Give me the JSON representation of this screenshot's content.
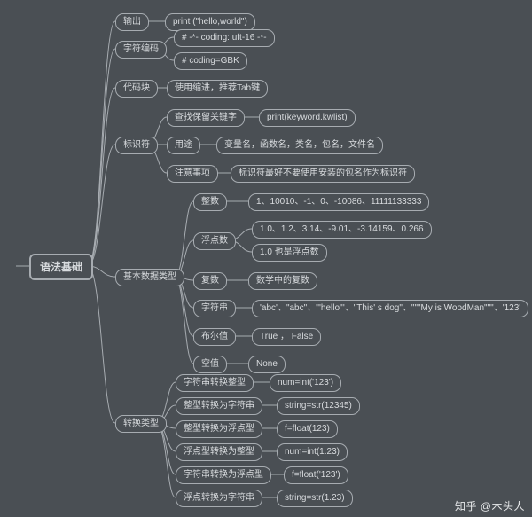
{
  "watermark": "知乎 @木头人",
  "root": {
    "label": "语法基础"
  },
  "b1": {
    "label": "输出"
  },
  "b1_1": {
    "label": "print (\"hello,world\")"
  },
  "b2": {
    "label": "字符编码"
  },
  "b2_1": {
    "label": "# -*- coding: uft-16 -*-"
  },
  "b2_2": {
    "label": "# coding=GBK"
  },
  "b3": {
    "label": "代码块"
  },
  "b3_1": {
    "label": "使用缩进，推荐Tab键"
  },
  "b4": {
    "label": "标识符"
  },
  "b4_1": {
    "label": "查找保留关键字"
  },
  "b4_1_1": {
    "label": "print(keyword.kwlist)"
  },
  "b4_2": {
    "label": "用途"
  },
  "b4_2_1": {
    "label": "变量名，函数名，类名，包名，文件名"
  },
  "b4_3": {
    "label": "注意事项"
  },
  "b4_3_1": {
    "label": "标识符最好不要使用安装的包名作为标识符"
  },
  "b5": {
    "label": "基本数据类型"
  },
  "b5_1": {
    "label": "整数"
  },
  "b5_1_1": {
    "label": "1、10010、-1、0、-10086、11111133333"
  },
  "b5_2": {
    "label": "浮点数"
  },
  "b5_2_1": {
    "label": "1.0、1.2、3.14、-9.01、-3.14159、0.266"
  },
  "b5_2_2": {
    "label": "1.0 也是浮点数"
  },
  "b5_3": {
    "label": "复数"
  },
  "b5_3_1": {
    "label": "数学中的复数"
  },
  "b5_4": {
    "label": "字符串"
  },
  "b5_4_1": {
    "label": "'abc'、\"abc\"、'''hello'''、\"This' s dog\"、\"\"\"My is WoodMan\"\"\"、'123'"
  },
  "b5_5": {
    "label": "布尔值"
  },
  "b5_5_1": {
    "label": "True ， False"
  },
  "b5_6": {
    "label": "空值"
  },
  "b5_6_1": {
    "label": "None"
  },
  "b6": {
    "label": "转换类型"
  },
  "b6_1": {
    "label": "字符串转换整型"
  },
  "b6_1_1": {
    "label": "num=int('123')"
  },
  "b6_2": {
    "label": "整型转换为字符串"
  },
  "b6_2_1": {
    "label": "string=str(12345)"
  },
  "b6_3": {
    "label": "整型转换为浮点型"
  },
  "b6_3_1": {
    "label": "f=float(123)"
  },
  "b6_4": {
    "label": "浮点型转换为整型"
  },
  "b6_4_1": {
    "label": "num=int(1.23)"
  },
  "b6_5": {
    "label": "字符串转换为浮点型"
  },
  "b6_5_1": {
    "label": "f=float('123')"
  },
  "b6_6": {
    "label": "浮点转换为字符串"
  },
  "b6_6_1": {
    "label": "string=str(1.23)"
  }
}
